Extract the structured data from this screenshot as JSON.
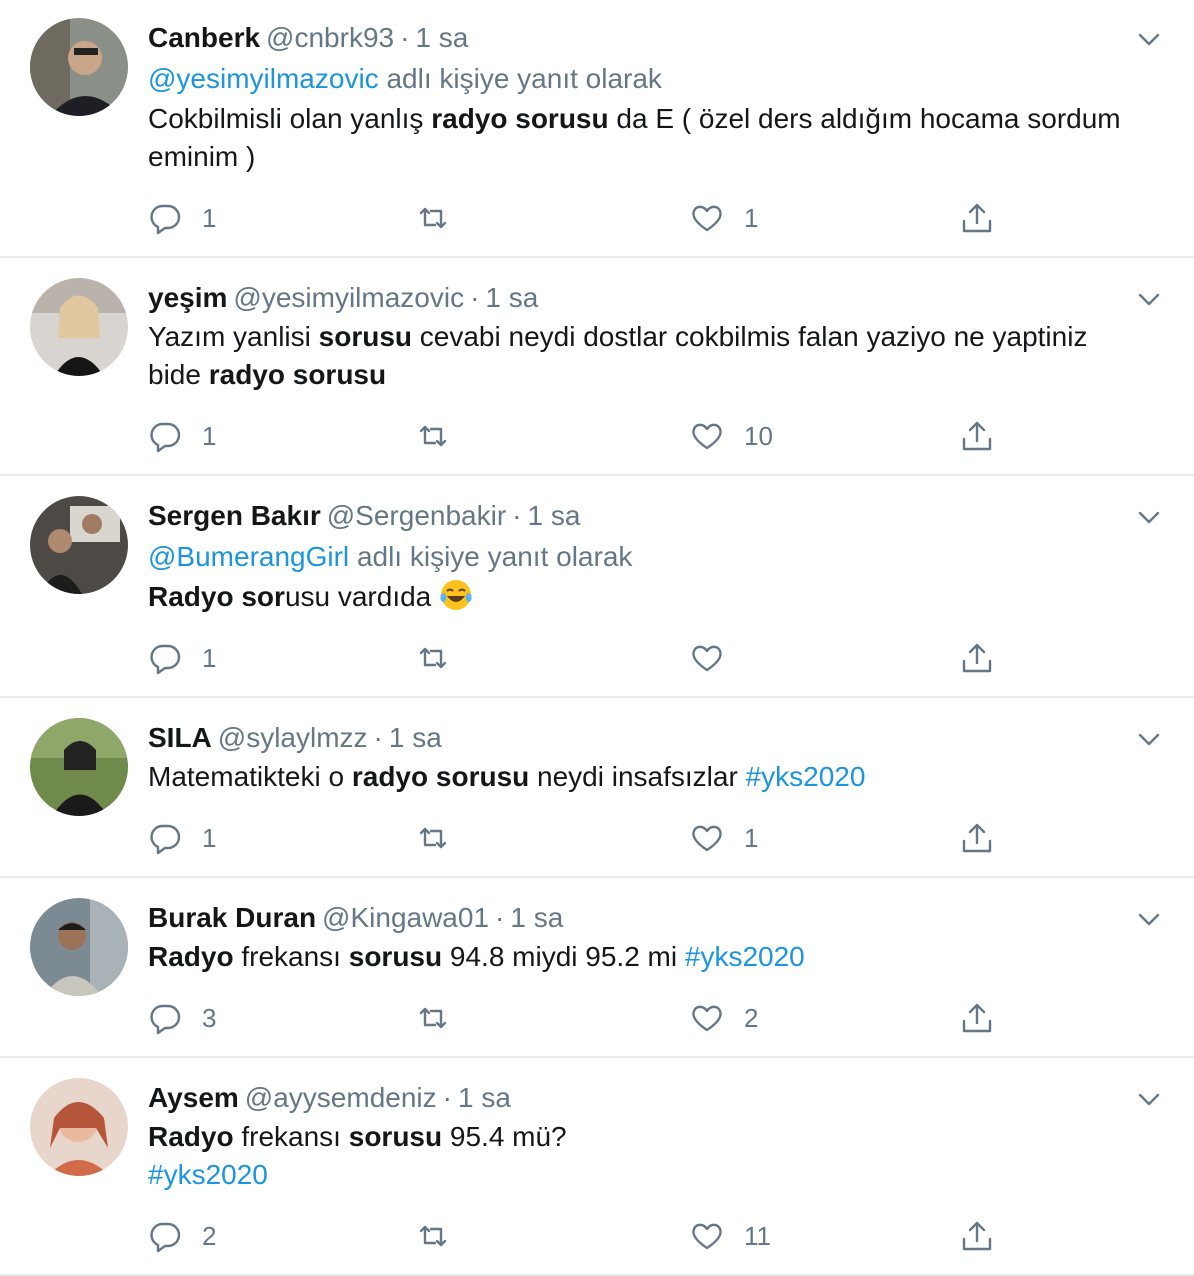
{
  "tweets": [
    {
      "name": "Canberk",
      "handle": "@cnbrk93",
      "dot": "·",
      "time": "1 sa",
      "reply_handle": "@yesimyilmazovic",
      "reply_suffix": "adlı kişiye yanıt olarak",
      "text": [
        {
          "t": "Cokbilmisli olan yanlış ",
          "b": false
        },
        {
          "t": "radyo sorusu",
          "b": true
        },
        {
          "t": " da E ( özel ders aldığım hocama sordum eminim )",
          "b": false
        }
      ],
      "replies": "1",
      "retweets": "",
      "likes": "1"
    },
    {
      "name": "yeşim",
      "handle": "@yesimyilmazovic",
      "dot": "·",
      "time": "1 sa",
      "text": [
        {
          "t": "Yazım yanlisi ",
          "b": false
        },
        {
          "t": "sorusu",
          "b": true
        },
        {
          "t": " cevabi neydi dostlar cokbilmis falan yaziyo ne yaptiniz bide ",
          "b": false
        },
        {
          "t": "radyo sorusu",
          "b": true
        }
      ],
      "replies": "1",
      "retweets": "",
      "likes": "10"
    },
    {
      "name": "Sergen Bakır",
      "handle": "@Sergenbakir",
      "dot": "·",
      "time": "1 sa",
      "reply_handle": "@BumerangGirl",
      "reply_suffix": "adlı kişiye yanıt olarak",
      "text": [
        {
          "t": "Radyo sor",
          "b": true
        },
        {
          "t": "usu vardıda ",
          "b": false
        }
      ],
      "emoji": "face-with-tears-of-joy",
      "replies": "1",
      "retweets": "",
      "likes": ""
    },
    {
      "name": "SILA",
      "handle": "@sylaylmzz",
      "dot": "·",
      "time": "1 sa",
      "text": [
        {
          "t": "Matematikteki o ",
          "b": false
        },
        {
          "t": "radyo sorusu",
          "b": true
        },
        {
          "t": " neydi insafsızlar ",
          "b": false
        },
        {
          "t": "#yks2020",
          "b": false,
          "link": true
        }
      ],
      "replies": "1",
      "retweets": "",
      "likes": "1"
    },
    {
      "name": "Burak Duran",
      "handle": "@Kingawa01",
      "dot": "·",
      "time": "1 sa",
      "text": [
        {
          "t": "Radyo",
          "b": true
        },
        {
          "t": " frekansı ",
          "b": false
        },
        {
          "t": "sorusu",
          "b": true
        },
        {
          "t": " 94.8 miydi 95.2 mi ",
          "b": false
        },
        {
          "t": "#yks2020",
          "b": false,
          "link": true
        }
      ],
      "replies": "3",
      "retweets": "",
      "likes": "2"
    },
    {
      "name": "Aysem",
      "handle": "@ayysemdeniz",
      "dot": "·",
      "time": "1 sa",
      "text": [
        {
          "t": "Radyo",
          "b": true
        },
        {
          "t": " frekansı ",
          "b": false
        },
        {
          "t": "sorusu",
          "b": true
        },
        {
          "t": " 95.4 mü?",
          "b": false
        },
        {
          "t": "\n",
          "b": false
        },
        {
          "t": "#yks2020",
          "b": false,
          "link": true
        }
      ],
      "replies": "2",
      "retweets": "",
      "likes": "11"
    }
  ],
  "icons": {
    "reply": "reply-icon",
    "retweet": "retweet-icon",
    "like": "heart-icon",
    "share": "share-icon",
    "menu": "chevron-down-icon"
  },
  "colors": {
    "link": "#1b95e0",
    "secondary": "#657786",
    "divider": "#e6ecf0"
  }
}
